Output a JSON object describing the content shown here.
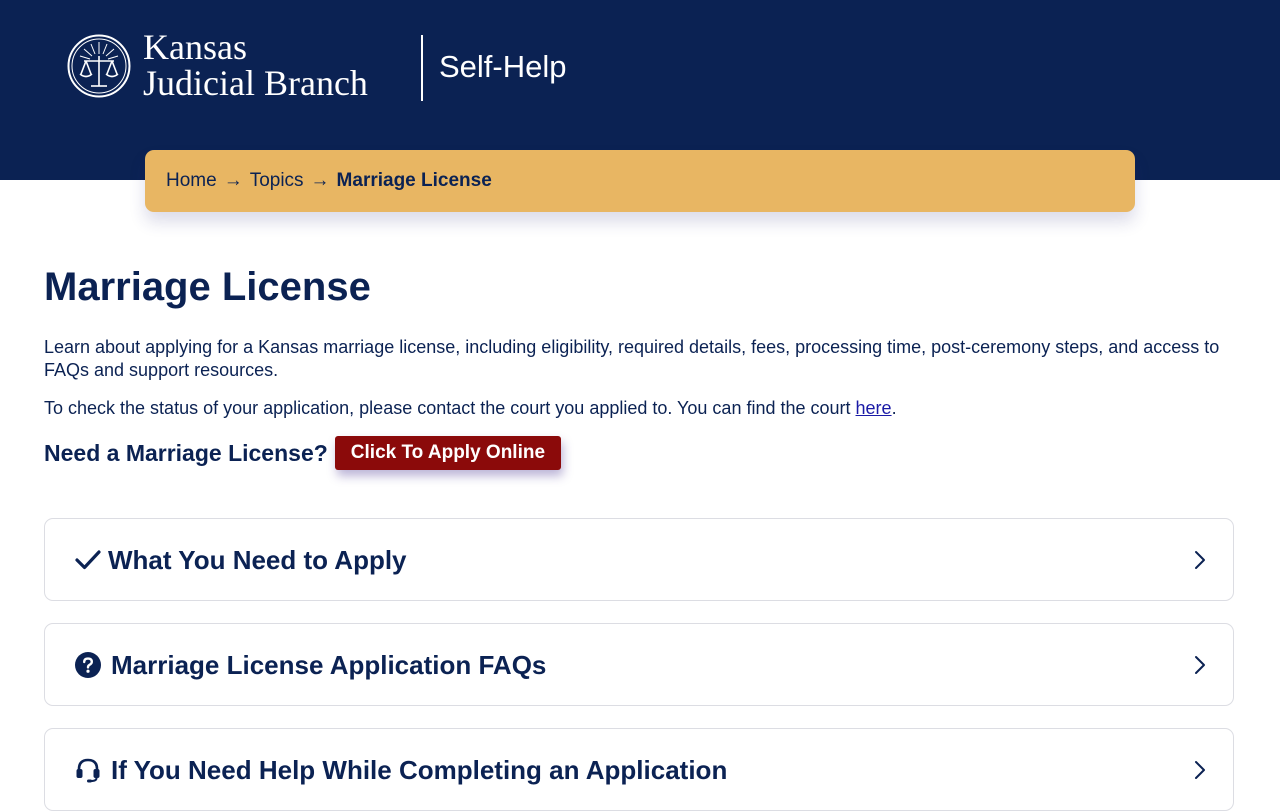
{
  "header": {
    "brand_line1": "Kansas",
    "brand_line2": "Judicial Branch",
    "section": "Self-Help",
    "logo_icon": "scales-of-justice-seal-icon"
  },
  "breadcrumb": {
    "items": [
      {
        "label": "Home"
      },
      {
        "label": "Topics"
      },
      {
        "label": "Marriage License"
      }
    ],
    "separator": "→"
  },
  "main": {
    "title": "Marriage License",
    "intro": "Learn about applying for a Kansas marriage license, including eligibility, required details, fees, processing time, post-ceremony steps, and access to FAQs and support resources.",
    "status_text": "To check the status of your application, please contact the court you applied to. You can find the court ",
    "status_link": "here",
    "status_end": ".",
    "need_label": "Need a Marriage License?",
    "apply_button": "Click To Apply Online"
  },
  "accordions": [
    {
      "title": "What You Need to Apply",
      "icon": "checkmark-icon"
    },
    {
      "title": "Marriage License Application FAQs",
      "icon": "question-circle-icon"
    },
    {
      "title": "If You Need Help While Completing an Application",
      "icon": "headset-icon"
    }
  ],
  "colors": {
    "navy": "#0b2253",
    "gold": "#e8b663",
    "button_red": "#8b0a0a",
    "link_blue": "#1a1aa6"
  }
}
